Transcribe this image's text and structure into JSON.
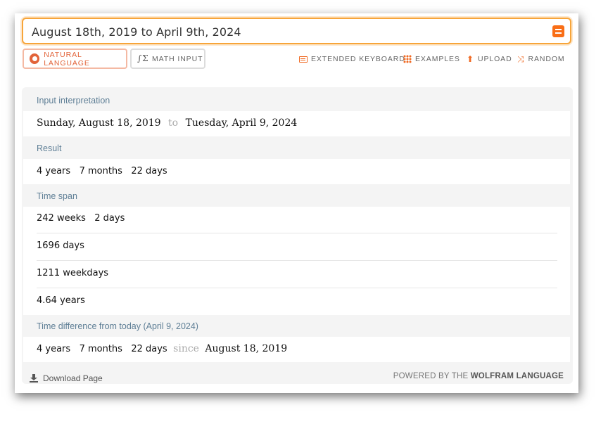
{
  "search": {
    "query": "August 18th, 2019 to April 9th, 2024"
  },
  "modes": {
    "natural_label": "NATURAL LANGUAGE",
    "math_label": "MATH INPUT"
  },
  "toolbar": {
    "keyboard_label": "EXTENDED KEYBOARD",
    "examples_label": "EXAMPLES",
    "upload_label": "UPLOAD",
    "random_label": "RANDOM"
  },
  "pods": {
    "interpretation": {
      "title": "Input interpretation",
      "start": "Sunday, August 18, 2019",
      "joiner": "to",
      "end": "Tuesday, April 9, 2024"
    },
    "result": {
      "title": "Result",
      "value": "4 years   7 months   22 days"
    },
    "timespan": {
      "title": "Time span",
      "rows": [
        "242 weeks   2 days",
        "1696 days",
        "1211 weekdays",
        "4.64 years"
      ]
    },
    "difference": {
      "title": "Time difference from today (April 9, 2024)",
      "value": "4 years   7 months   22 days",
      "joiner": "since",
      "date": "August 18, 2019"
    }
  },
  "footer": {
    "download_label": "Download Page",
    "powered_prefix": "POWERED BY THE",
    "powered_brand": "WOLFRAM LANGUAGE"
  },
  "colors": {
    "accent": "#f96e16",
    "pod_title": "#5f7f96",
    "search_border": "#f7a53a"
  }
}
